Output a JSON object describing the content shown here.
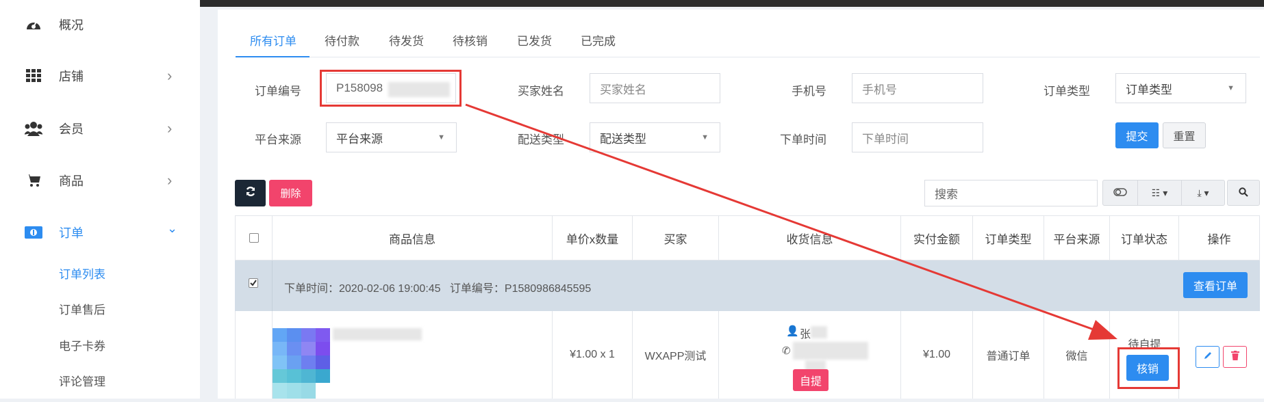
{
  "sidebar": {
    "items": [
      {
        "label": "概况",
        "icon": "dashboard-icon",
        "chevron": ""
      },
      {
        "label": "店铺",
        "icon": "grid-icon",
        "chevron": "›"
      },
      {
        "label": "会员",
        "icon": "users-icon",
        "chevron": "›"
      },
      {
        "label": "商品",
        "icon": "cart-icon",
        "chevron": "›"
      },
      {
        "label": "订单",
        "icon": "money-icon",
        "chevron": "⌄"
      }
    ],
    "sub_items": [
      "订单列表",
      "订单售后",
      "电子卡券",
      "评论管理"
    ]
  },
  "tabs": [
    "所有订单",
    "待付款",
    "待发货",
    "待核销",
    "已发货",
    "已完成"
  ],
  "filters": {
    "order_no_label": "订单编号",
    "order_no_value": "P158098",
    "buyer_name_label": "买家姓名",
    "buyer_name_placeholder": "买家姓名",
    "phone_label": "手机号",
    "phone_placeholder": "手机号",
    "order_type_label": "订单类型",
    "order_type_value": "订单类型",
    "platform_label": "平台来源",
    "platform_value": "平台来源",
    "delivery_label": "配送类型",
    "delivery_value": "配送类型",
    "order_time_label": "下单时间",
    "order_time_placeholder": "下单时间",
    "submit": "提交",
    "reset": "重置"
  },
  "toolbar": {
    "delete": "删除",
    "search_placeholder": "搜索"
  },
  "table": {
    "headers": [
      "商品信息",
      "单价x数量",
      "买家",
      "收货信息",
      "实付金额",
      "订单类型",
      "平台来源",
      "订单状态",
      "操作"
    ],
    "group": {
      "text": "下单时间：2020-02-06 19:00:45   订单编号：P1580986845595",
      "view_button": "查看订单"
    },
    "row": {
      "price_qty": "¥1.00 x 1",
      "buyer": "WXAPP测试",
      "receiver_name": "张",
      "pickup_badge": "自提",
      "paid": "¥1.00",
      "order_type": "普通订单",
      "platform": "微信",
      "status": "待自提",
      "verify_button": "核销"
    }
  },
  "colors": {
    "primary": "#2d8cf0",
    "danger": "#f2446c",
    "annotation": "#e53935"
  }
}
